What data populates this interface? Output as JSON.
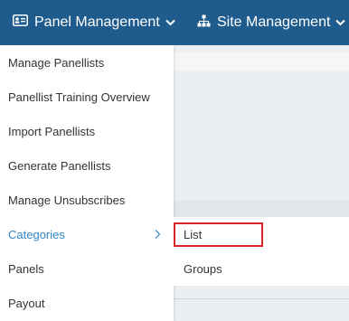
{
  "topbar": {
    "panel_management": {
      "label": "Panel Management",
      "icon": "id-card-icon"
    },
    "site_management": {
      "label": "Site Management",
      "icon": "sitemap-icon"
    }
  },
  "panel_menu": {
    "items": [
      {
        "label": "Manage Panellists"
      },
      {
        "label": "Panellist Training Overview"
      },
      {
        "label": "Import Panellists"
      },
      {
        "label": "Generate Panellists"
      },
      {
        "label": "Manage Unsubscribes"
      },
      {
        "label": "Categories",
        "active": true,
        "has_submenu": true
      },
      {
        "label": "Panels"
      },
      {
        "label": "Payout"
      }
    ]
  },
  "categories_submenu": {
    "items": [
      {
        "label": "List",
        "highlighted": true
      },
      {
        "label": "Groups"
      }
    ]
  },
  "colors": {
    "navbar": "#1f5b8c",
    "active_text": "#2f86c8",
    "highlight_border": "#d9232a"
  }
}
